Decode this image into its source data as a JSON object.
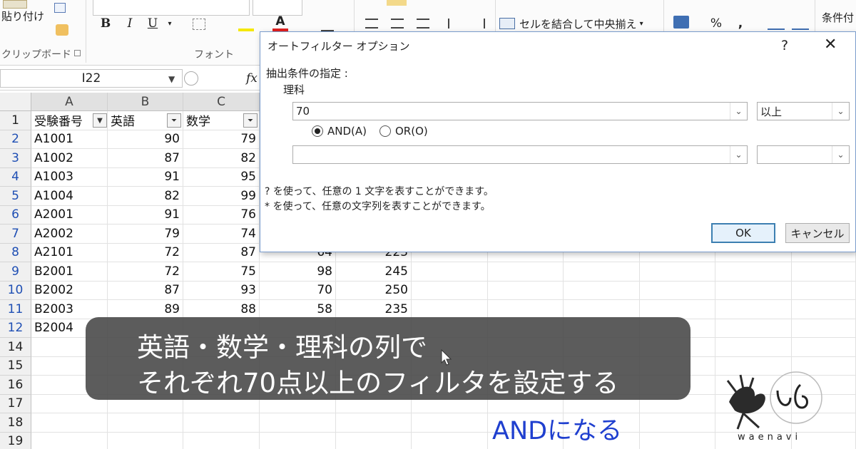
{
  "ribbon": {
    "paste_label": "貼り付け",
    "clipboard_label": "クリップボード",
    "font_label": "フォント",
    "bold": "B",
    "italic": "I",
    "underline": "U",
    "font_color_letter": "A",
    "merge_center": "セルを結合して中央揃え",
    "percent": "%",
    "comma": ",",
    "conditional": "条件付"
  },
  "formula_bar": {
    "name_box": "I22",
    "fx": "fx"
  },
  "sheet": {
    "columns": [
      "A",
      "B",
      "C"
    ],
    "headers": [
      "受験番号",
      "英語",
      "数学"
    ],
    "rows": [
      {
        "n": "1"
      },
      {
        "n": "2",
        "id": "A1001",
        "eng": "90",
        "math": "79"
      },
      {
        "n": "3",
        "id": "A1002",
        "eng": "87",
        "math": "82"
      },
      {
        "n": "4",
        "id": "A1003",
        "eng": "91",
        "math": "95"
      },
      {
        "n": "5",
        "id": "A1004",
        "eng": "82",
        "math": "99"
      },
      {
        "n": "6",
        "id": "A2001",
        "eng": "91",
        "math": "76"
      },
      {
        "n": "7",
        "id": "A2002",
        "eng": "79",
        "math": "74"
      },
      {
        "n": "8",
        "id": "A2101",
        "eng": "72",
        "math": "87",
        "sci": "64",
        "total": "223"
      },
      {
        "n": "9",
        "id": "B2001",
        "eng": "72",
        "math": "75",
        "sci": "98",
        "total": "245"
      },
      {
        "n": "10",
        "id": "B2002",
        "eng": "87",
        "math": "93",
        "sci": "70",
        "total": "250"
      },
      {
        "n": "11",
        "id": "B2003",
        "eng": "89",
        "math": "88",
        "sci": "58",
        "total": "235"
      },
      {
        "n": "12",
        "id": "B2004"
      },
      {
        "n": "14"
      },
      {
        "n": "15"
      },
      {
        "n": "16"
      },
      {
        "n": "17"
      },
      {
        "n": "18"
      },
      {
        "n": "19"
      }
    ]
  },
  "dialog": {
    "title": "オートフィルター オプション",
    "help": "?",
    "close": "✕",
    "heading": "抽出条件の指定 :",
    "field": "理科",
    "value1": "70",
    "operator1": "以上",
    "and_label": "AND(A)",
    "or_label": "OR(O)",
    "value2": "",
    "operator2": "",
    "hint1": "? を使って、任意の 1 文字を表すことができます。",
    "hint2": "* を使って、任意の文字列を表すことができます。",
    "ok": "OK",
    "cancel": "キャンセル"
  },
  "caption": {
    "line1": "英語・数学・理科の列で",
    "line2": "それぞれ70点以上のフィルタを設定する",
    "note": "ANDになる"
  },
  "logo": {
    "text": "waenavi"
  },
  "colors": {
    "filtered_row": "#1f4fb4",
    "note_blue": "#1f3fcf",
    "caption_bg": "#464646"
  }
}
